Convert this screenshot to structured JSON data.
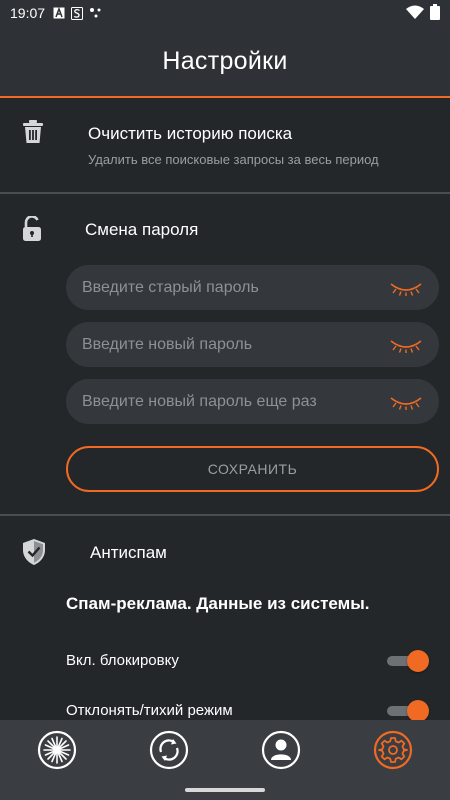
{
  "status_bar": {
    "time": "19:07",
    "icons": [
      "a-icon",
      "s-icon",
      "dots-icon",
      "wifi-icon",
      "battery-icon"
    ]
  },
  "app_bar": {
    "title": "Настройки"
  },
  "clear_history": {
    "icon": "trash-icon",
    "title": "Очистить историю поиска",
    "subtitle": "Удалить все поисковые запросы за весь период"
  },
  "password": {
    "icon": "lock-icon",
    "title": "Смена пароля",
    "fields": [
      {
        "placeholder": "Введите старый пароль",
        "value": ""
      },
      {
        "placeholder": "Введите новый пароль",
        "value": ""
      },
      {
        "placeholder": "Введите новый пароль еще раз",
        "value": ""
      }
    ],
    "save_label": "СОХРАНИТЬ"
  },
  "antispam": {
    "icon": "shield-check-icon",
    "title": "Антиспам",
    "heading": "Спам-реклама. Данные из системы.",
    "toggles": [
      {
        "label": "Вкл. блокировку",
        "on": true
      },
      {
        "label": "Отклонять/тихий режим",
        "on": true
      }
    ]
  },
  "bottom_nav": {
    "items": [
      {
        "name": "burst-icon",
        "active": false
      },
      {
        "name": "sync-icon",
        "active": false
      },
      {
        "name": "profile-icon",
        "active": false
      },
      {
        "name": "settings-icon",
        "active": true
      }
    ]
  },
  "colors": {
    "accent": "#f06a23",
    "background": "#24272a",
    "bar": "#2e3236",
    "field": "#34383c",
    "muted": "#9a9ea3"
  }
}
